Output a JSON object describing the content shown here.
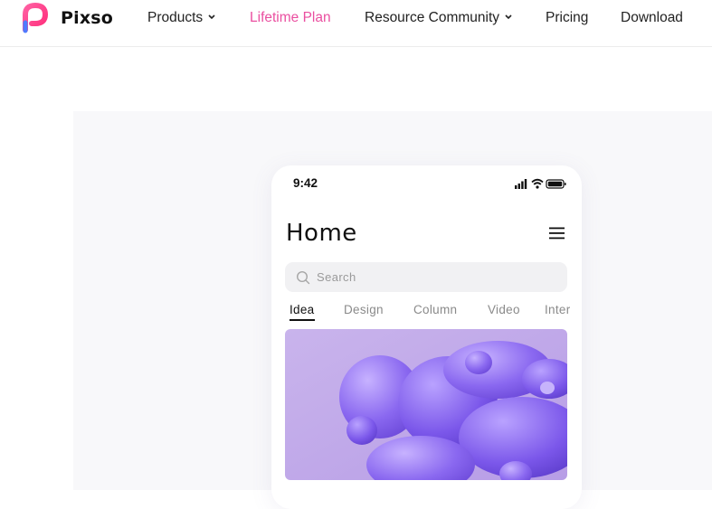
{
  "brand": {
    "name": "Pixso"
  },
  "nav": {
    "items": [
      {
        "label": "Products",
        "has_dropdown": true
      },
      {
        "label": "Lifetime Plan",
        "has_dropdown": false
      },
      {
        "label": "Resource Community",
        "has_dropdown": true
      },
      {
        "label": "Pricing",
        "has_dropdown": false
      },
      {
        "label": "Download",
        "has_dropdown": false
      }
    ],
    "accent_color": "#ea4fa0"
  },
  "phone": {
    "time": "9:42",
    "status_icons": [
      "signal-icon",
      "wifi-icon",
      "battery-icon"
    ],
    "title": "Home",
    "search_placeholder": "Search",
    "tabs": [
      {
        "label": "Idea",
        "active": true
      },
      {
        "label": "Design",
        "active": false
      },
      {
        "label": "Column",
        "active": false
      },
      {
        "label": "Video",
        "active": false
      },
      {
        "label": "Inter",
        "active": false
      }
    ],
    "featured_image": "purple-3d-shapes-image"
  }
}
